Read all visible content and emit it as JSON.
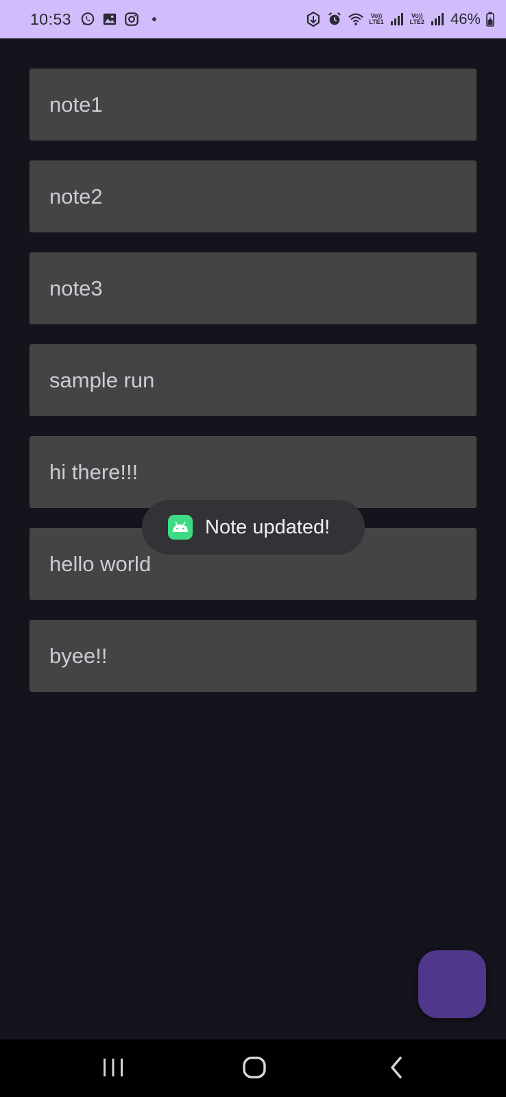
{
  "status_bar": {
    "time": "10:53",
    "notification_icons": [
      "whatsapp-icon",
      "gallery-icon",
      "instagram-icon",
      "dot-icon"
    ],
    "system_icons": [
      "data-saver-icon",
      "alarm-icon",
      "wifi-icon",
      "volte-lte1-signal-icon",
      "volte-lte2-signal-icon"
    ],
    "sim1_top": "Vo))",
    "sim1_bottom": "LTE1",
    "sim2_top": "Vo))",
    "sim2_bottom": "LTE2",
    "battery": "46%"
  },
  "notes": [
    {
      "title": "note1"
    },
    {
      "title": "note2"
    },
    {
      "title": "note3"
    },
    {
      "title": "sample run"
    },
    {
      "title": "hi there!!!"
    },
    {
      "title": "hello world"
    },
    {
      "title": "byee!!"
    }
  ],
  "toast": {
    "icon": "android-icon",
    "message": "Note updated!"
  },
  "fab": {
    "icon": "none"
  },
  "nav_bar": {
    "buttons": [
      "recents-icon",
      "home-icon",
      "back-icon"
    ]
  },
  "colors": {
    "status_bar_bg": "#d1bdfb",
    "screen_bg": "#15131b",
    "card_bg": "#444444",
    "card_text": "#cfcbd6",
    "toast_bg": "#333236",
    "fab_bg": "#4f378b",
    "android_green": "#3ddc84"
  }
}
